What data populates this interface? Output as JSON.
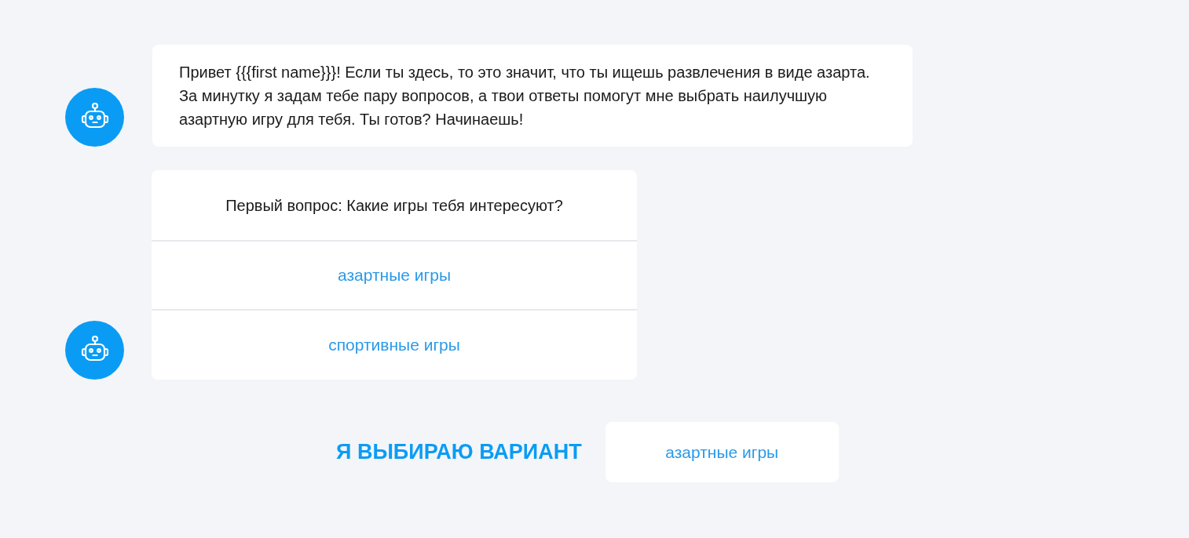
{
  "messages": [
    {
      "kind": "text",
      "text": "Привет {{{first name}}}! Если ты здесь, то это значит, что ты ищешь развлечения в виде азарта. За минутку я задам тебе пару вопросов, а твои ответы помогут мне выбрать наилучшую азартную игру для тебя. Ты готов? Начинаешь!"
    },
    {
      "kind": "question",
      "text": "Первый вопрос: Какие игры тебя интересуют?",
      "options": [
        "азартные игры",
        "спортивные игры"
      ]
    }
  ],
  "choice": {
    "label": "Я ВЫБИРАЮ ВАРИАНТ",
    "value": "азартные игры"
  }
}
